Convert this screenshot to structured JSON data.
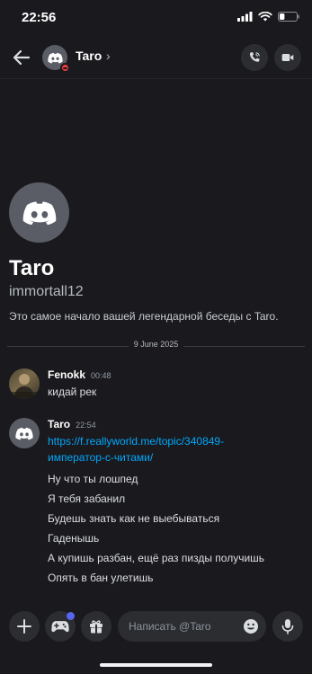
{
  "status_bar": {
    "time": "22:56",
    "battery_level": 0.3
  },
  "header": {
    "name": "Taro",
    "chevron": "›",
    "status": "dnd"
  },
  "intro": {
    "name": "Taro",
    "username": "immortall12",
    "description": "Это самое начало вашей легендарной беседы с Taro."
  },
  "date_divider": "9 June 2025",
  "messages": [
    {
      "author": "Fenokk",
      "time": "00:48",
      "lines": [
        "кидай рек"
      ]
    },
    {
      "author": "Taro",
      "time": "22:54",
      "link_lines": [
        "https://f.reallyworld.me/topic/340849-",
        "император-с-читами/"
      ],
      "lines": [
        "Ну что ты лошпед",
        "Я тебя забанил",
        "Будешь знать как не выебываться",
        "Гаденышь",
        "А купишь разбан, ещё раз пизды получишь",
        "Опять в бан улетишь"
      ]
    }
  ],
  "composer": {
    "placeholder": "Написать @Taro"
  },
  "colors": {
    "background": "#1a1a1e",
    "link": "#00a8fc",
    "dnd": "#f23f43",
    "accent": "#5865f2"
  }
}
